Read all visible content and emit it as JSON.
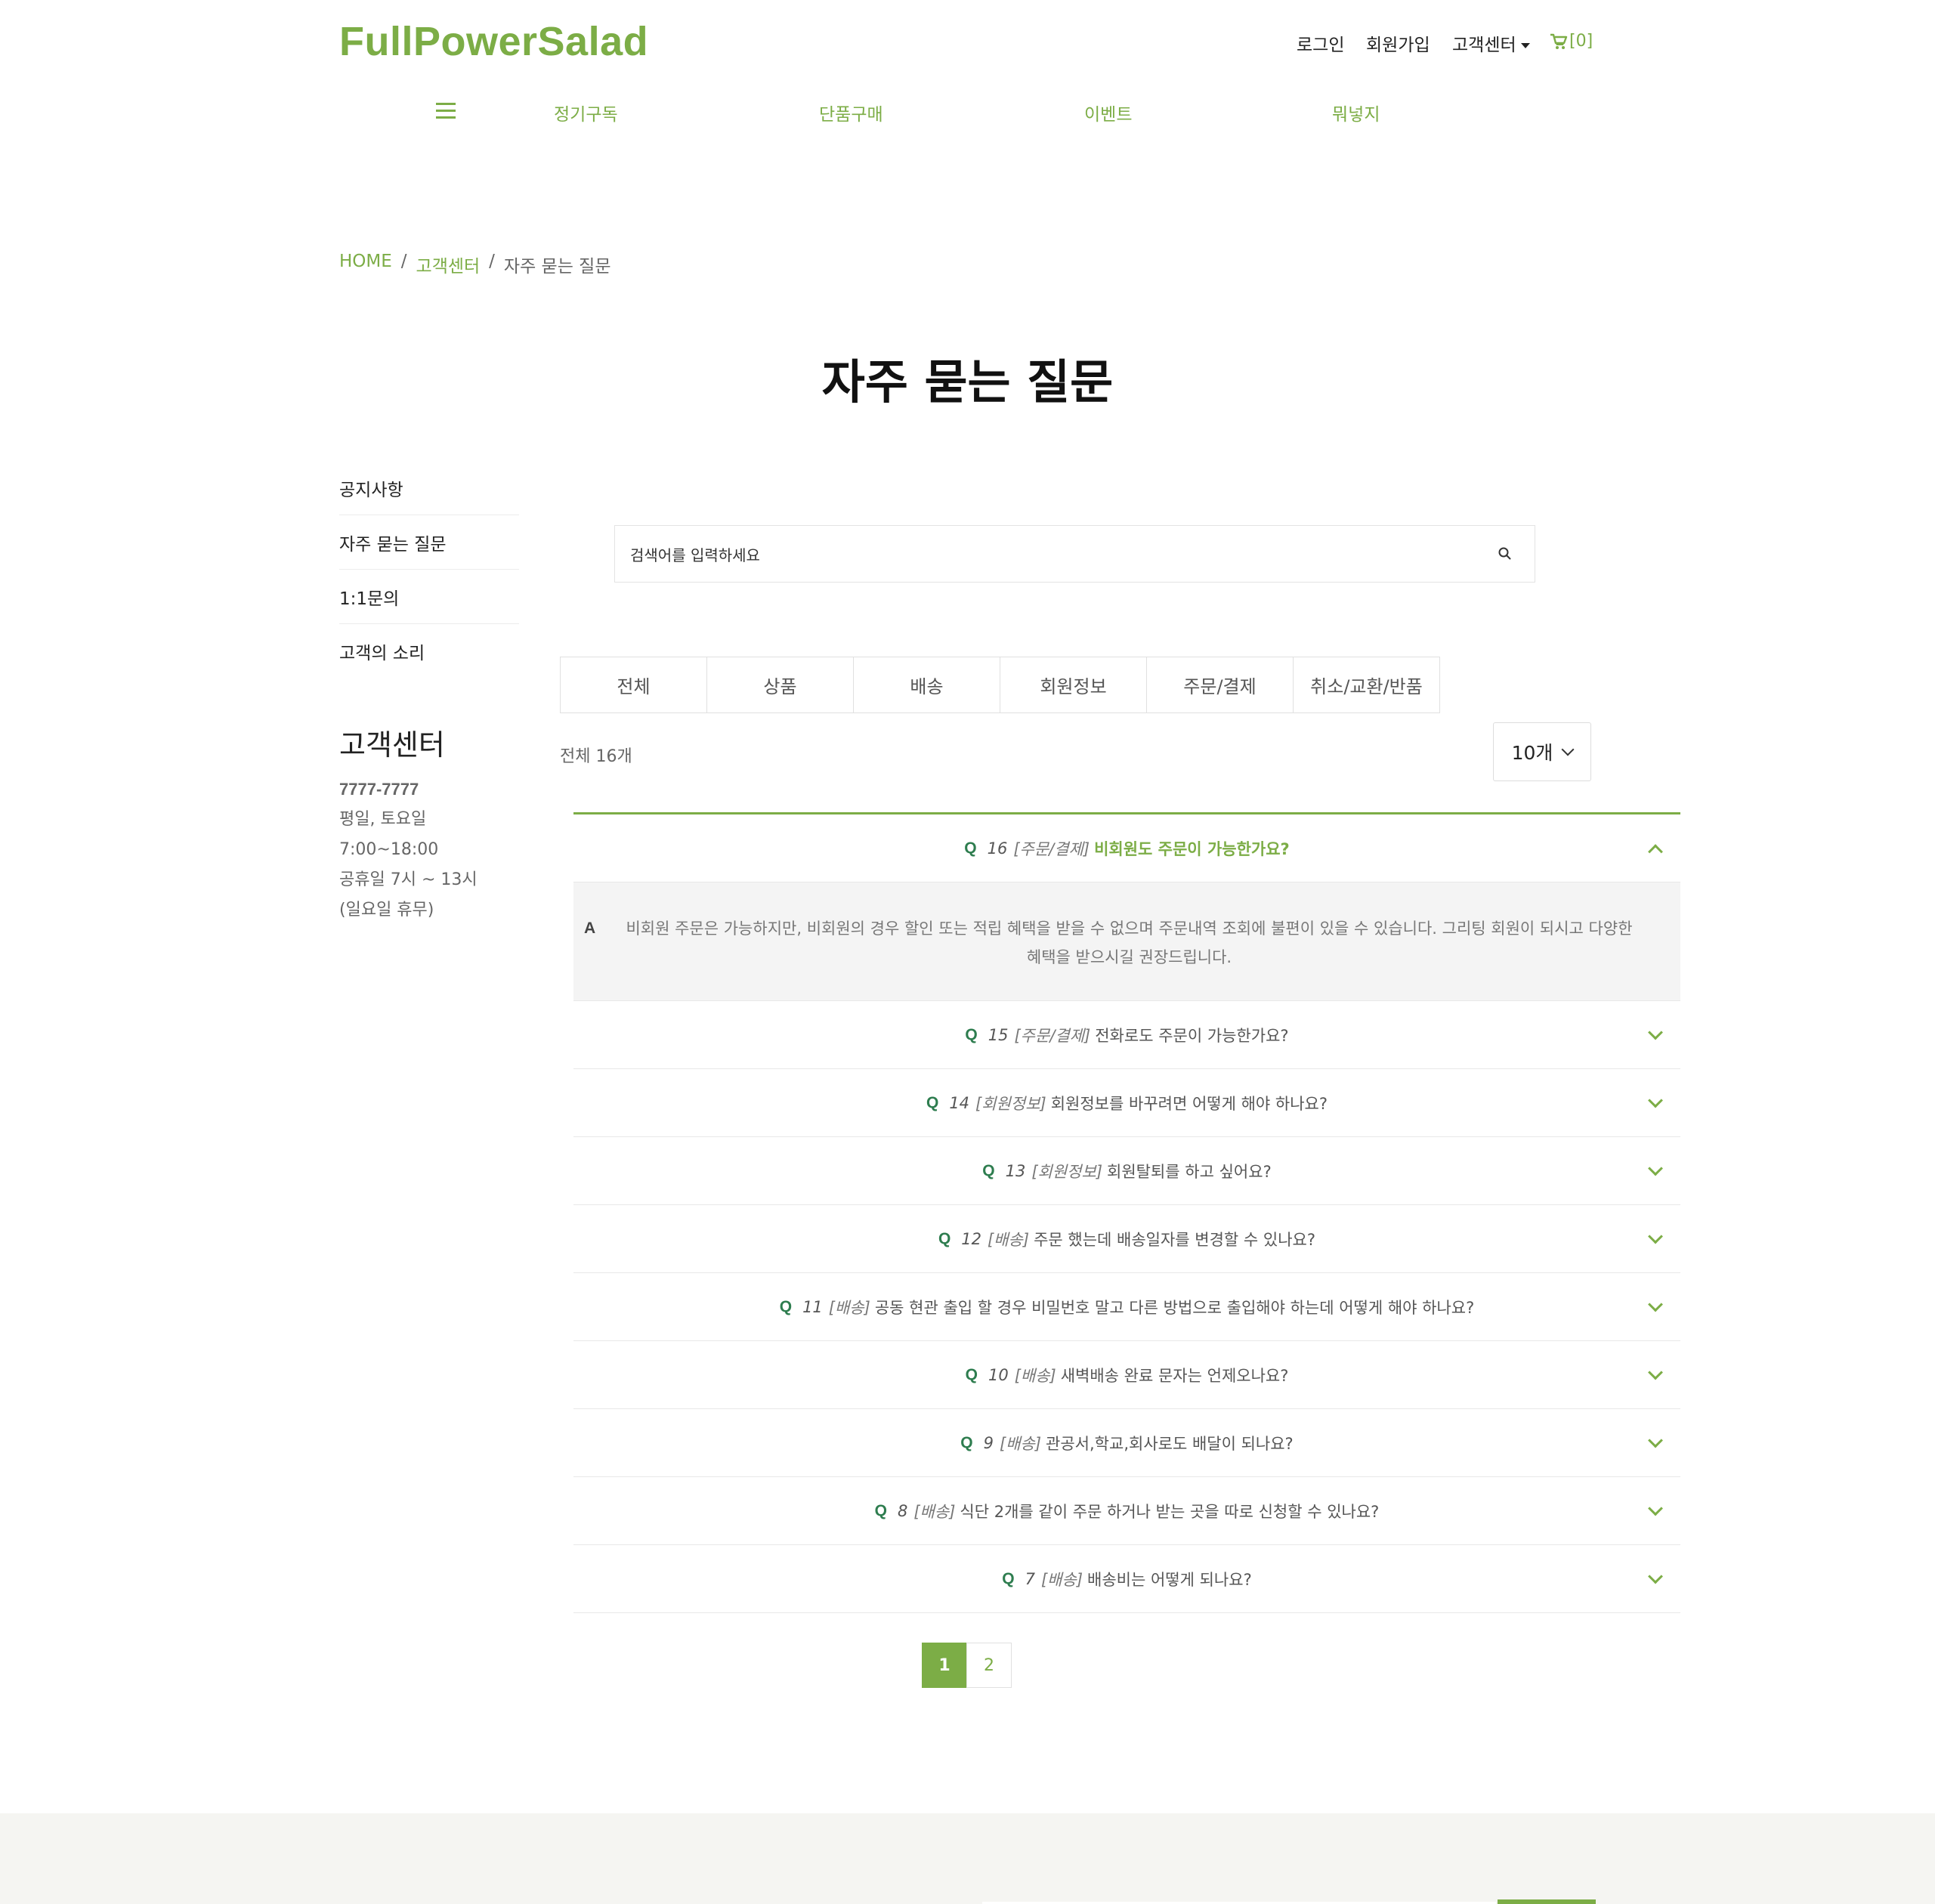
{
  "header": {
    "logo": "FullPowerSalad",
    "util": {
      "login": "로그인",
      "signup": "회원가입",
      "support": "고객센터",
      "cart": "[0]"
    },
    "nav": [
      "정기구독",
      "단품구매",
      "이벤트",
      "뭐넣지"
    ]
  },
  "breadcrumb": {
    "home": "HOME",
    "sep": "/",
    "section": "고객센터",
    "current": "자주 묻는 질문"
  },
  "page_title": "자주 묻는 질문",
  "side_menu": [
    "공지사항",
    "자주 묻는 질문",
    "1:1문의",
    "고객의 소리"
  ],
  "cs": {
    "title": "고객센터",
    "tel": "7777-7777",
    "days": "평일, 토요일",
    "hours": "7:00~18:00",
    "holiday": "공휴일 7시 ~ 13시",
    "sunday": "(일요일 휴무)"
  },
  "search": {
    "placeholder": "검색어를 입력하세요"
  },
  "tabs": [
    "전체",
    "상품",
    "배송",
    "회원정보",
    "주문/결제",
    "취소/교환/반품"
  ],
  "total": "전체 16개",
  "page_size": "10개",
  "faq": [
    {
      "q": "Q",
      "num": "16",
      "cat": "[주문/결제]",
      "text": "비회원도 주문이 가능한가요?",
      "open": true
    },
    {
      "q": "Q",
      "num": "15",
      "cat": "[주문/결제]",
      "text": "전화로도 주문이 가능한가요?"
    },
    {
      "q": "Q",
      "num": "14",
      "cat": "[회원정보]",
      "text": "회원정보를 바꾸려면 어떻게 해야 하나요?"
    },
    {
      "q": "Q",
      "num": "13",
      "cat": "[회원정보]",
      "text": "회원탈퇴를 하고 싶어요?"
    },
    {
      "q": "Q",
      "num": "12",
      "cat": "[배송]",
      "text": "주문 했는데 배송일자를 변경할 수 있나요?"
    },
    {
      "q": "Q",
      "num": "11",
      "cat": "[배송]",
      "text": "공동 현관 출입 할 경우 비밀번호 말고 다른 방법으로 출입해야 하는데 어떻게 해야 하나요?"
    },
    {
      "q": "Q",
      "num": "10",
      "cat": "[배송]",
      "text": "새벽배송 완료 문자는 언제오나요?"
    },
    {
      "q": "Q",
      "num": "9",
      "cat": "[배송]",
      "text": "관공서,학교,회사로도 배달이 되나요?"
    },
    {
      "q": "Q",
      "num": "8",
      "cat": "[배송]",
      "text": "식단 2개를 같이 주문 하거나 받는 곳을 따로 신청할 수 있나요?"
    },
    {
      "q": "Q",
      "num": "7",
      "cat": "[배송]",
      "text": "배송비는 어떻게 되나요?"
    }
  ],
  "answer": {
    "a": "A",
    "line1": "비회원 주문은 가능하지만, 비회원의 경우 할인 또는 적립 혜택을 받을 수 없으며 주문내역 조회에 불편이 있을 수 있습니다. 그리팅 회원이 되시고 다양한",
    "line2": "혜택을 받으시길 권장드립니다."
  },
  "pagination": [
    "1",
    "2"
  ],
  "colors": {
    "accent": "#7cad46",
    "q_mark": "#2e7d4f"
  }
}
